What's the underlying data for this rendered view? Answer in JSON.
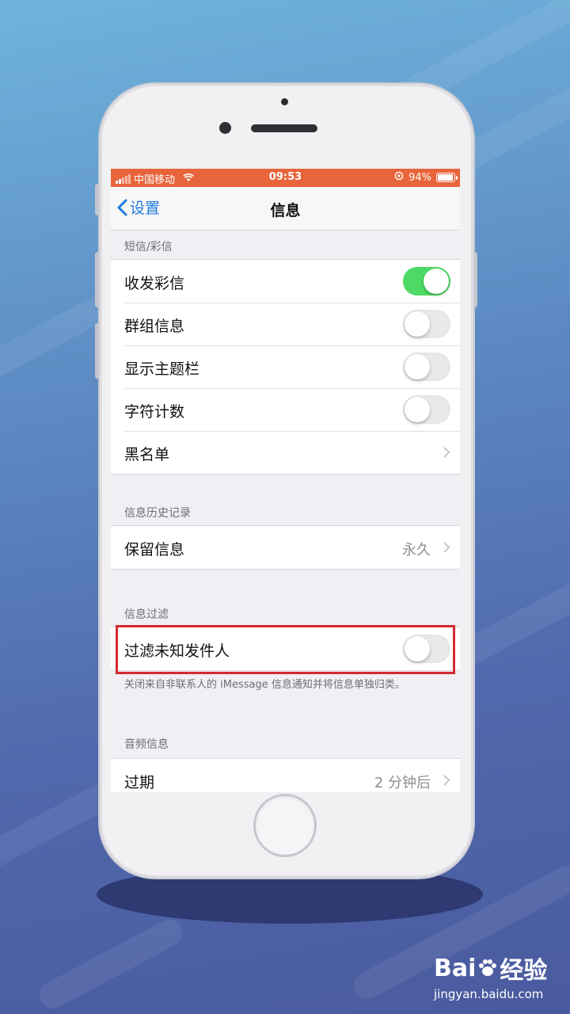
{
  "status_bar": {
    "carrier": "中国移动",
    "time": "09:53",
    "battery": "94%",
    "battery_level": 0.94,
    "color": "#e8643a"
  },
  "nav": {
    "back_label": "设置",
    "title": "信息"
  },
  "sections": {
    "sms": {
      "header": "短信/彩信",
      "rows": [
        {
          "label": "收发彩信",
          "type": "toggle",
          "on": true
        },
        {
          "label": "群组信息",
          "type": "toggle",
          "on": false
        },
        {
          "label": "显示主题栏",
          "type": "toggle",
          "on": false
        },
        {
          "label": "字符计数",
          "type": "toggle",
          "on": false
        },
        {
          "label": "黑名单",
          "type": "disclosure"
        }
      ]
    },
    "history": {
      "header": "信息历史记录",
      "rows": [
        {
          "label": "保留信息",
          "value": "永久",
          "type": "disclosure"
        }
      ]
    },
    "filter": {
      "header": "信息过滤",
      "rows": [
        {
          "label": "过滤未知发件人",
          "type": "toggle",
          "on": false
        }
      ],
      "footer": "关闭来自非联系人的 iMessage 信息通知并将信息单独归类。"
    },
    "audio": {
      "header": "音频信息",
      "rows": [
        {
          "label": "过期",
          "value": "2 分钟后",
          "type": "disclosure"
        }
      ]
    }
  },
  "watermark": {
    "brand_left": "Bai",
    "brand_right": "经验",
    "url": "jingyan.baidu.com"
  },
  "colors": {
    "accent": "#1f7ae0",
    "toggle_on": "#4cd964",
    "highlight": "#d42a33"
  }
}
